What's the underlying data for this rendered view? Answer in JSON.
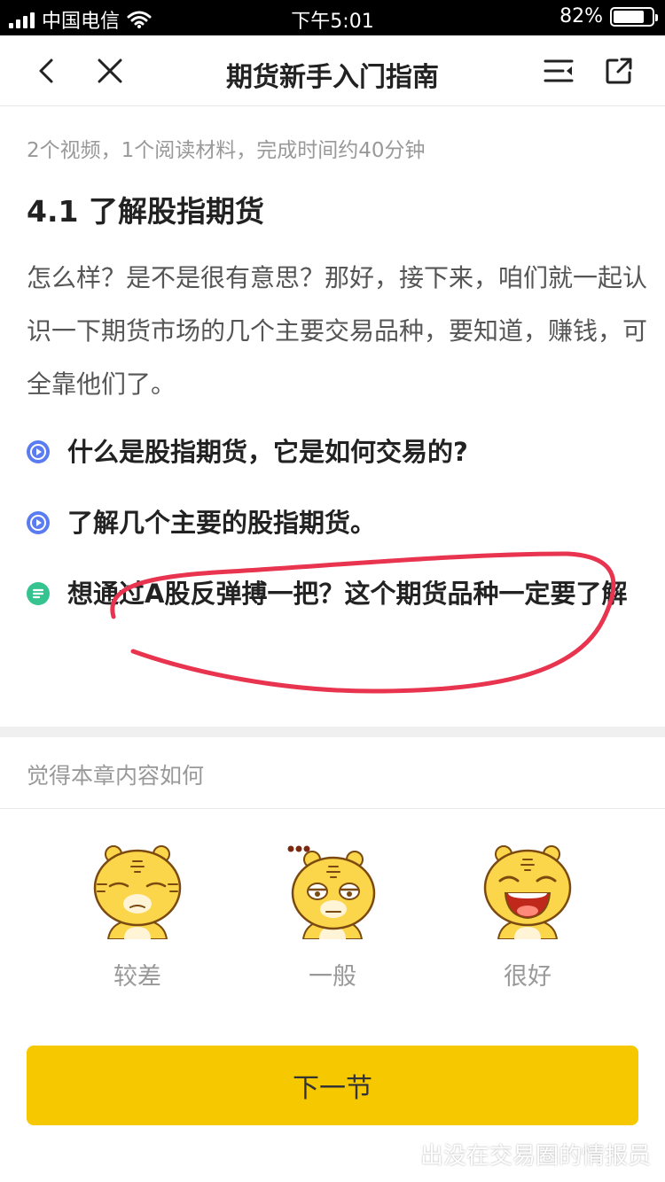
{
  "status_bar": {
    "carrier": "中国电信",
    "time": "下午5:01",
    "battery": "82%",
    "battery_level": 0.82
  },
  "nav": {
    "title": "期货新手入门指南",
    "icons": [
      "back-chevron-icon",
      "close-icon",
      "menu-list-icon",
      "share-icon"
    ]
  },
  "content": {
    "meta": "2个视频，1个阅读材料，完成时间约40分钟",
    "section_title": "4.1 了解股指期货",
    "intro": "怎么样？是不是很有意思？那好，接下来，咱们就一起认识一下期货市场的几个主要交易品种，要知道，赚钱，可全靠他们了。",
    "lessons": [
      {
        "type": "video",
        "icon": "play-icon",
        "text": "什么是股指期货，它是如何交易的?"
      },
      {
        "type": "video",
        "icon": "play-icon",
        "text": "了解几个主要的股指期货。"
      },
      {
        "type": "reading",
        "icon": "document-icon",
        "text": "想通过A股反弹搏一把？这个期货品种一定要了解"
      }
    ]
  },
  "rating": {
    "prompt": "觉得本章内容如何",
    "options": [
      {
        "label": "较差",
        "icon": "tiger-sad-face-icon"
      },
      {
        "label": "一般",
        "icon": "tiger-meh-face-icon"
      },
      {
        "label": "很好",
        "icon": "tiger-happy-face-icon"
      }
    ]
  },
  "footer": {
    "next_label": "下一节"
  },
  "watermark": {
    "text": "出没在交易圈的情报员"
  },
  "colors": {
    "accent": "#f5c800",
    "video_icon": "#5b7cf0",
    "reading_icon": "#35c38f",
    "annotation_stroke": "#e8344e"
  }
}
